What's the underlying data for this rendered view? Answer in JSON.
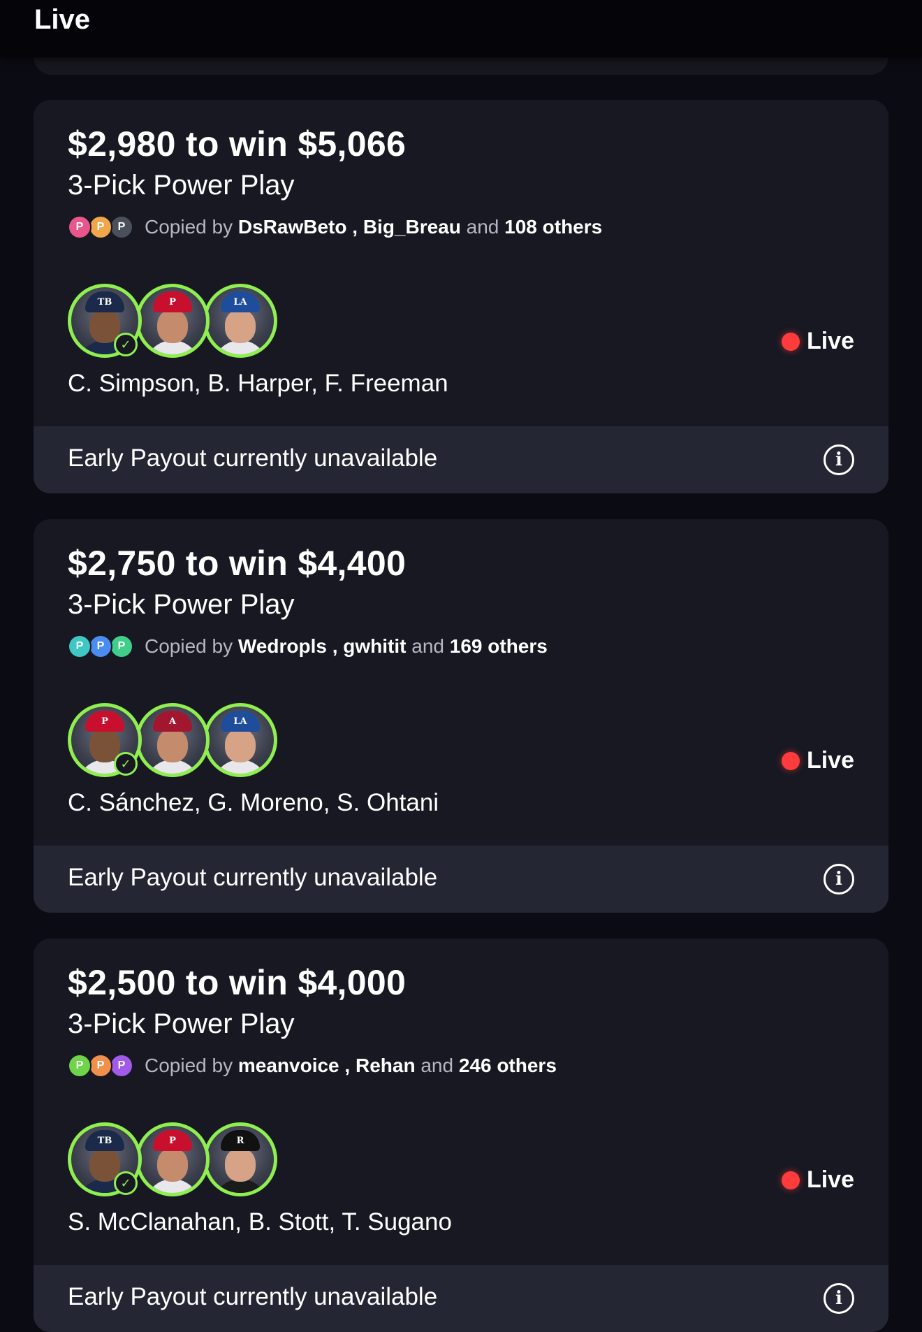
{
  "header": {
    "title": "Live"
  },
  "cards": [
    {
      "amount": "$2,980 to win $5,066",
      "type": "3-Pick Power Play",
      "copied_prefix": "Copied by",
      "copier1": "DsRawBeto",
      "sep": ",",
      "copier2": "Big_Breau",
      "and": "and",
      "others": "108 others",
      "mini_colors": [
        "#e8568c",
        "#f0a64a",
        "#4a4f5c"
      ],
      "players": "C. Simpson, B. Harper, F. Freeman",
      "caps": [
        "TB",
        "P",
        "LA"
      ],
      "cap_colors": [
        "#1b2a4a",
        "#c8102e",
        "#1e4d9b"
      ],
      "jersey_colors": [
        "#1b2a4a",
        "#e8e8ec",
        "#e8e8ec"
      ],
      "live": "Live",
      "payout": "Early Payout currently unavailable"
    },
    {
      "amount": "$2,750 to win $4,400",
      "type": "3-Pick Power Play",
      "copied_prefix": "Copied by",
      "copier1": "Wedropls",
      "sep": ",",
      "copier2": "gwhitit",
      "and": "and",
      "others": "169 others",
      "mini_colors": [
        "#3fc7c3",
        "#4a8cf0",
        "#3fcf8a"
      ],
      "players": "C. Sánchez, G. Moreno, S. Ohtani",
      "caps": [
        "P",
        "A",
        "LA"
      ],
      "cap_colors": [
        "#c8102e",
        "#a3162f",
        "#1e4d9b"
      ],
      "jersey_colors": [
        "#e8e8ec",
        "#e8e8ec",
        "#e8e8ec"
      ],
      "live": "Live",
      "payout": "Early Payout currently unavailable"
    },
    {
      "amount": "$2,500 to win $4,000",
      "type": "3-Pick Power Play",
      "copied_prefix": "Copied by",
      "copier1": "meanvoice",
      "sep": ",",
      "copier2": "Rehan",
      "and": "and",
      "others": "246 others",
      "mini_colors": [
        "#6fd44a",
        "#f0904a",
        "#a25be8"
      ],
      "players": "S. McClanahan, B. Stott, T. Sugano",
      "caps": [
        "TB",
        "P",
        "R"
      ],
      "cap_colors": [
        "#1b2a4a",
        "#c8102e",
        "#111111"
      ],
      "jersey_colors": [
        "#1b2a4a",
        "#e8e8ec",
        "#1b1b1b"
      ],
      "live": "Live",
      "payout": "Early Payout currently unavailable"
    }
  ],
  "icons": {
    "info": "i",
    "check": "✓",
    "mini": "P"
  }
}
